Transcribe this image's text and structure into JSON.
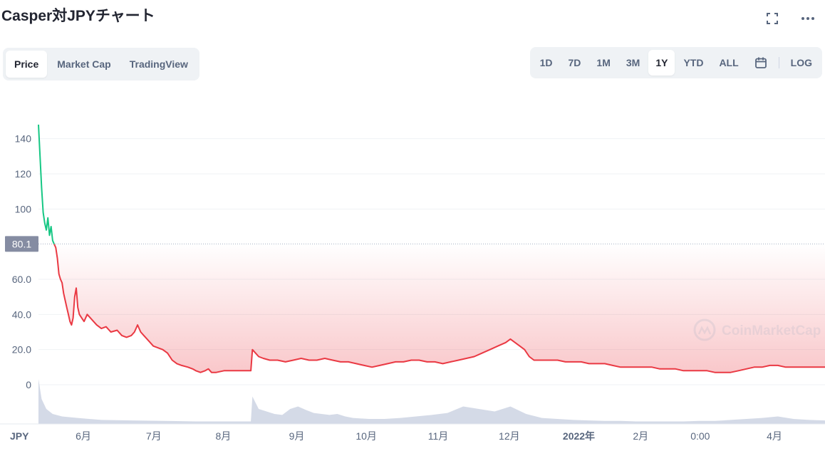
{
  "title": "Casper対JPYチャート",
  "top_icons": {
    "fullscreen": "fullscreen-icon",
    "more": "more-icon"
  },
  "view_tabs": [
    {
      "label": "Price",
      "active": true
    },
    {
      "label": "Market Cap",
      "active": false
    },
    {
      "label": "TradingView",
      "active": false
    }
  ],
  "range_tabs": [
    {
      "label": "1D",
      "active": false
    },
    {
      "label": "7D",
      "active": false
    },
    {
      "label": "1M",
      "active": false
    },
    {
      "label": "3M",
      "active": false
    },
    {
      "label": "1Y",
      "active": true
    },
    {
      "label": "YTD",
      "active": false
    },
    {
      "label": "ALL",
      "active": false
    }
  ],
  "log_label": "LOG",
  "calendar_icon": "calendar-icon",
  "watermark": "CoinMarketCap",
  "colors": {
    "up": "#16c784",
    "down": "#ea3943",
    "grid": "#eff2f5",
    "axis_text": "#58667e",
    "volume": "#cfd6e4",
    "badge": "#858ca2"
  },
  "chart_data": {
    "type": "area",
    "currency_label": "JPY",
    "reference_value": 80.1,
    "reference_label": "80.1",
    "ylim": [
      0,
      150
    ],
    "y_ticks": [
      {
        "v": 0,
        "label": "0"
      },
      {
        "v": 20,
        "label": "20.0"
      },
      {
        "v": 40,
        "label": "40.0"
      },
      {
        "v": 60,
        "label": "60.0"
      },
      {
        "v": 100,
        "label": "100"
      },
      {
        "v": 120,
        "label": "120"
      },
      {
        "v": 140,
        "label": "140"
      }
    ],
    "x_ticks": [
      {
        "t": 0.176,
        "label": "6月",
        "bold": false
      },
      {
        "t": 0.267,
        "label": "7月",
        "bold": false
      },
      {
        "t": 0.357,
        "label": "8月",
        "bold": false
      },
      {
        "t": 0.452,
        "label": "9月",
        "bold": false
      },
      {
        "t": 0.542,
        "label": "10月",
        "bold": false
      },
      {
        "t": 0.635,
        "label": "11月",
        "bold": false
      },
      {
        "t": 0.727,
        "label": "12月",
        "bold": false
      },
      {
        "t": 0.817,
        "label": "2022年",
        "bold": true
      },
      {
        "t": 0.897,
        "label": "2月",
        "bold": false
      },
      {
        "t": 0.974,
        "label": "0:00",
        "bold": false
      },
      {
        "t": 1.07,
        "label": "4月",
        "bold": false
      }
    ],
    "series": [
      {
        "points": [
          [
            0.0,
            148
          ],
          [
            0.002,
            130
          ],
          [
            0.004,
            112
          ],
          [
            0.006,
            98
          ],
          [
            0.008,
            92
          ],
          [
            0.01,
            88
          ],
          [
            0.012,
            95
          ],
          [
            0.014,
            85
          ],
          [
            0.016,
            90
          ],
          [
            0.018,
            82
          ],
          [
            0.02,
            80
          ],
          [
            0.022,
            78
          ],
          [
            0.024,
            72
          ],
          [
            0.026,
            63
          ],
          [
            0.028,
            60
          ],
          [
            0.03,
            58
          ],
          [
            0.032,
            52
          ],
          [
            0.034,
            48
          ],
          [
            0.036,
            44
          ],
          [
            0.038,
            40
          ],
          [
            0.04,
            36
          ],
          [
            0.042,
            34
          ],
          [
            0.044,
            38
          ],
          [
            0.046,
            50
          ],
          [
            0.048,
            55
          ],
          [
            0.05,
            44
          ],
          [
            0.052,
            40
          ],
          [
            0.055,
            38
          ],
          [
            0.058,
            36
          ],
          [
            0.062,
            40
          ],
          [
            0.066,
            38
          ],
          [
            0.07,
            36
          ],
          [
            0.074,
            34
          ],
          [
            0.08,
            32
          ],
          [
            0.086,
            33
          ],
          [
            0.092,
            30
          ],
          [
            0.1,
            31
          ],
          [
            0.106,
            28
          ],
          [
            0.112,
            27
          ],
          [
            0.118,
            28
          ],
          [
            0.122,
            30
          ],
          [
            0.126,
            34
          ],
          [
            0.13,
            30
          ],
          [
            0.134,
            28
          ],
          [
            0.14,
            25
          ],
          [
            0.146,
            22
          ],
          [
            0.152,
            21
          ],
          [
            0.158,
            20
          ],
          [
            0.164,
            18
          ],
          [
            0.17,
            14
          ],
          [
            0.176,
            12
          ],
          [
            0.182,
            11
          ],
          [
            0.19,
            10
          ],
          [
            0.196,
            9
          ],
          [
            0.2,
            8
          ],
          [
            0.206,
            7
          ],
          [
            0.212,
            8
          ],
          [
            0.216,
            9
          ],
          [
            0.22,
            7
          ],
          [
            0.226,
            7
          ],
          [
            0.236,
            8
          ],
          [
            0.246,
            8
          ],
          [
            0.256,
            8
          ],
          [
            0.266,
            8
          ],
          [
            0.27,
            8
          ],
          [
            0.272,
            20
          ],
          [
            0.276,
            18
          ],
          [
            0.28,
            16
          ],
          [
            0.286,
            15
          ],
          [
            0.294,
            14
          ],
          [
            0.304,
            14
          ],
          [
            0.314,
            13
          ],
          [
            0.324,
            14
          ],
          [
            0.334,
            15
          ],
          [
            0.344,
            14
          ],
          [
            0.354,
            14
          ],
          [
            0.364,
            15
          ],
          [
            0.374,
            14
          ],
          [
            0.384,
            13
          ],
          [
            0.394,
            13
          ],
          [
            0.404,
            12
          ],
          [
            0.414,
            11
          ],
          [
            0.424,
            10
          ],
          [
            0.434,
            11
          ],
          [
            0.444,
            12
          ],
          [
            0.454,
            13
          ],
          [
            0.464,
            13
          ],
          [
            0.474,
            14
          ],
          [
            0.484,
            14
          ],
          [
            0.494,
            13
          ],
          [
            0.504,
            13
          ],
          [
            0.514,
            12
          ],
          [
            0.524,
            13
          ],
          [
            0.534,
            14
          ],
          [
            0.544,
            15
          ],
          [
            0.554,
            16
          ],
          [
            0.564,
            18
          ],
          [
            0.574,
            20
          ],
          [
            0.584,
            22
          ],
          [
            0.594,
            24
          ],
          [
            0.6,
            26
          ],
          [
            0.606,
            24
          ],
          [
            0.612,
            22
          ],
          [
            0.618,
            20
          ],
          [
            0.624,
            16
          ],
          [
            0.63,
            14
          ],
          [
            0.64,
            14
          ],
          [
            0.65,
            14
          ],
          [
            0.66,
            14
          ],
          [
            0.67,
            13
          ],
          [
            0.68,
            13
          ],
          [
            0.69,
            13
          ],
          [
            0.7,
            12
          ],
          [
            0.71,
            12
          ],
          [
            0.72,
            12
          ],
          [
            0.73,
            11
          ],
          [
            0.74,
            10
          ],
          [
            0.75,
            10
          ],
          [
            0.76,
            10
          ],
          [
            0.77,
            10
          ],
          [
            0.78,
            10
          ],
          [
            0.79,
            9
          ],
          [
            0.8,
            9
          ],
          [
            0.81,
            9
          ],
          [
            0.82,
            8
          ],
          [
            0.83,
            8
          ],
          [
            0.84,
            8
          ],
          [
            0.85,
            8
          ],
          [
            0.86,
            7
          ],
          [
            0.87,
            7
          ],
          [
            0.88,
            7
          ],
          [
            0.89,
            8
          ],
          [
            0.9,
            9
          ],
          [
            0.91,
            10
          ],
          [
            0.92,
            10
          ],
          [
            0.93,
            11
          ],
          [
            0.94,
            11
          ],
          [
            0.95,
            10
          ],
          [
            0.96,
            10
          ],
          [
            0.97,
            10
          ],
          [
            0.98,
            10
          ],
          [
            0.99,
            10
          ],
          [
            1.0,
            10
          ]
        ]
      }
    ],
    "volume": [
      [
        0.0,
        0.9
      ],
      [
        0.004,
        0.5
      ],
      [
        0.01,
        0.3
      ],
      [
        0.018,
        0.2
      ],
      [
        0.03,
        0.15
      ],
      [
        0.05,
        0.12
      ],
      [
        0.08,
        0.08
      ],
      [
        0.12,
        0.07
      ],
      [
        0.16,
        0.06
      ],
      [
        0.2,
        0.05
      ],
      [
        0.24,
        0.05
      ],
      [
        0.27,
        0.05
      ],
      [
        0.272,
        0.55
      ],
      [
        0.28,
        0.3
      ],
      [
        0.29,
        0.25
      ],
      [
        0.3,
        0.2
      ],
      [
        0.31,
        0.18
      ],
      [
        0.32,
        0.3
      ],
      [
        0.33,
        0.35
      ],
      [
        0.34,
        0.28
      ],
      [
        0.35,
        0.22
      ],
      [
        0.36,
        0.2
      ],
      [
        0.37,
        0.18
      ],
      [
        0.38,
        0.2
      ],
      [
        0.39,
        0.15
      ],
      [
        0.4,
        0.12
      ],
      [
        0.42,
        0.1
      ],
      [
        0.44,
        0.1
      ],
      [
        0.46,
        0.12
      ],
      [
        0.48,
        0.15
      ],
      [
        0.5,
        0.18
      ],
      [
        0.52,
        0.22
      ],
      [
        0.54,
        0.35
      ],
      [
        0.56,
        0.3
      ],
      [
        0.58,
        0.25
      ],
      [
        0.6,
        0.35
      ],
      [
        0.62,
        0.2
      ],
      [
        0.64,
        0.12
      ],
      [
        0.66,
        0.1
      ],
      [
        0.68,
        0.08
      ],
      [
        0.7,
        0.07
      ],
      [
        0.72,
        0.06
      ],
      [
        0.74,
        0.06
      ],
      [
        0.76,
        0.05
      ],
      [
        0.78,
        0.05
      ],
      [
        0.8,
        0.05
      ],
      [
        0.82,
        0.05
      ],
      [
        0.84,
        0.06
      ],
      [
        0.86,
        0.06
      ],
      [
        0.88,
        0.08
      ],
      [
        0.9,
        0.1
      ],
      [
        0.92,
        0.12
      ],
      [
        0.94,
        0.15
      ],
      [
        0.96,
        0.1
      ],
      [
        0.98,
        0.08
      ],
      [
        1.0,
        0.07
      ]
    ]
  }
}
